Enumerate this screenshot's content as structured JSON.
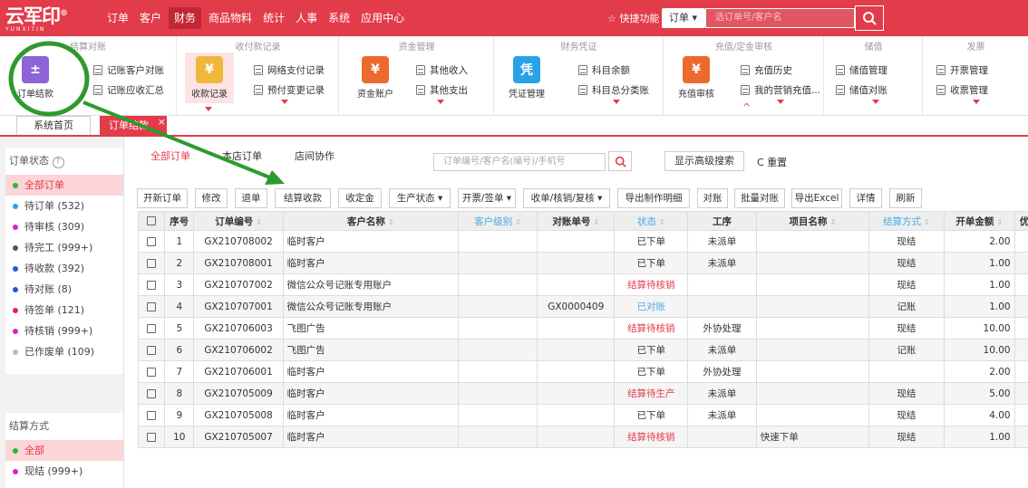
{
  "app": {
    "logo_main": "云军印",
    "logo_reg": "®",
    "logo_sub": "YUNXITIN"
  },
  "nav": {
    "items": [
      "订单",
      "客户",
      "财务",
      "商品物料",
      "统计",
      "人事",
      "系统",
      "应用中心"
    ],
    "active": "财务"
  },
  "header": {
    "quick_label": "快捷功能",
    "order_select": "订单",
    "search_placeholder": "选订单号/客户名"
  },
  "ribbon": {
    "groups": [
      {
        "title": "结算对账",
        "big": "订单结款",
        "small": [
          "记账客户对账",
          "记账应收汇总"
        ]
      },
      {
        "title": "收付款记录",
        "big": "收款记录",
        "small": [
          "网络支付记录",
          "预付变更记录"
        ]
      },
      {
        "title": "资金管理",
        "big": "资金账户",
        "small": [
          "其他收入",
          "其他支出"
        ]
      },
      {
        "title": "财务凭证",
        "big": "凭证管理",
        "small": [
          "科目余额",
          "科目总分类账"
        ]
      },
      {
        "title": "充值/定金审核",
        "big": "充值审核",
        "small": [
          "充值历史",
          "我的营销充值..."
        ]
      },
      {
        "title": "储值",
        "small": [
          "储值管理",
          "储值对账"
        ]
      },
      {
        "title": "发票",
        "small": [
          "开票管理",
          "收票管理"
        ]
      }
    ]
  },
  "tabs": {
    "home": "系统首页",
    "current": "订单结款",
    "close": "×"
  },
  "sidebar": {
    "status_title": "订单状态",
    "help": "?",
    "status_items": [
      {
        "label": "全部订单",
        "color": "#2eb82e",
        "selected": true
      },
      {
        "label": "待订单 (532)",
        "color": "#1fa9e8"
      },
      {
        "label": "待审核 (309)",
        "color": "#e020c8"
      },
      {
        "label": "待完工 (999+)",
        "color": "#555555"
      },
      {
        "label": "待收款 (392)",
        "color": "#2a55e0"
      },
      {
        "label": "待对账 (8)",
        "color": "#2a55e0"
      },
      {
        "label": "待签单 (121)",
        "color": "#e0207a"
      },
      {
        "label": "待核销 (999+)",
        "color": "#e020c8"
      },
      {
        "label": "已作废单 (109)",
        "color": "#bbbbbb"
      }
    ],
    "settle_title": "结算方式",
    "settle_items": [
      {
        "label": "全部",
        "color": "#2eb82e",
        "selected": true
      },
      {
        "label": "现结 (999+)",
        "color": "#e020c8"
      }
    ]
  },
  "filter": {
    "tabs": [
      "全部订单",
      "本店订单",
      "店间协作"
    ],
    "search_placeholder": "订单编号/客户名(编号)/手机号",
    "advanced": "显示高级搜索",
    "reset": "重置"
  },
  "toolbar": [
    "开新订单",
    "修改",
    "退单",
    "结算收款",
    "收定金",
    "生产状态 ▾",
    "开票/签单 ▾",
    "收单/核销/复核 ▾",
    "导出制作明细",
    "对账",
    "批量对账",
    "导出Excel",
    "详情",
    "刷新"
  ],
  "table": {
    "headers": [
      "序号",
      "订单编号",
      "客户名称",
      "客户级别",
      "对账单号",
      "状态",
      "工序",
      "项目名称",
      "结算方式",
      "开单金额",
      "优惠"
    ],
    "rows": [
      {
        "no": "1",
        "order": "GX210708002",
        "customer": "临时客户",
        "level": "",
        "recon": "",
        "status": "已下单",
        "status_color": "#333333",
        "process": "未派单",
        "project": "",
        "settle": "现结",
        "amount": "2.00"
      },
      {
        "no": "2",
        "order": "GX210708001",
        "customer": "临时客户",
        "level": "",
        "recon": "",
        "status": "已下单",
        "status_color": "#333333",
        "process": "未派单",
        "project": "",
        "settle": "现结",
        "amount": "1.00"
      },
      {
        "no": "3",
        "order": "GX210707002",
        "customer": "微信公众号记账专用账户",
        "level": "",
        "recon": "",
        "status": "结算待核销",
        "status_color": "#e23b4a",
        "process": "",
        "project": "",
        "settle": "现结",
        "amount": "1.00"
      },
      {
        "no": "4",
        "order": "GX210707001",
        "customer": "微信公众号记账专用账户",
        "level": "",
        "recon": "GX0000409",
        "status": "已对账",
        "status_color": "#4aa8e8",
        "process": "",
        "project": "",
        "settle": "记账",
        "amount": "1.00"
      },
      {
        "no": "5",
        "order": "GX210706003",
        "customer": "飞图广告",
        "level": "",
        "recon": "",
        "status": "结算待核销",
        "status_color": "#e23b4a",
        "process": "外协处理",
        "project": "",
        "settle": "现结",
        "amount": "10.00"
      },
      {
        "no": "6",
        "order": "GX210706002",
        "customer": "飞图广告",
        "level": "",
        "recon": "",
        "status": "已下单",
        "status_color": "#333333",
        "process": "未派单",
        "project": "",
        "settle": "记账",
        "amount": "10.00"
      },
      {
        "no": "7",
        "order": "GX210706001",
        "customer": "临时客户",
        "level": "",
        "recon": "",
        "status": "已下单",
        "status_color": "#333333",
        "process": "外协处理",
        "project": "",
        "settle": "",
        "amount": "2.00"
      },
      {
        "no": "8",
        "order": "GX210705009",
        "customer": "临时客户",
        "level": "",
        "recon": "",
        "status": "结算待生产",
        "status_color": "#e23b4a",
        "process": "未派单",
        "project": "",
        "settle": "现结",
        "amount": "5.00"
      },
      {
        "no": "9",
        "order": "GX210705008",
        "customer": "临时客户",
        "level": "",
        "recon": "",
        "status": "已下单",
        "status_color": "#333333",
        "process": "未派单",
        "project": "",
        "settle": "现结",
        "amount": "4.00"
      },
      {
        "no": "10",
        "order": "GX210705007",
        "customer": "临时客户",
        "level": "",
        "recon": "",
        "status": "结算待核销",
        "status_color": "#e23b4a",
        "process": "",
        "project": "快速下单",
        "settle": "现结",
        "amount": "1.00"
      }
    ]
  },
  "colors": {
    "brand": "#e23b4a",
    "annotation": "#2e9a2e"
  }
}
